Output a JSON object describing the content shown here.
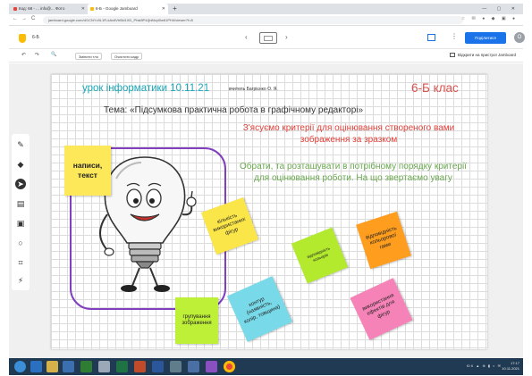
{
  "browser": {
    "tabs": [
      {
        "label": "Код: 68 - ... info@... Фото",
        "active": false
      },
      {
        "label": "6-Б - Google Jamboard",
        "active": true
      }
    ],
    "new_tab": "+",
    "window_controls": "— ▢ ✕",
    "url": "jamboard.google.com/d/1CNYc9L1R-kAv6Vhl5d1XD_Phsl8P4JjbMzyl0w61PH4/viewer?f=8",
    "nav": {
      "back": "←",
      "forward": "→",
      "reload": "C"
    }
  },
  "app": {
    "title": "6-Б",
    "share_label": "Поділитися",
    "avatar_letter": "О",
    "frame_prev": "‹",
    "frame_next": "›",
    "toolbar": {
      "undo": "↶",
      "redo": "↷",
      "zoom": "🔍",
      "set_background": "Змінити тло",
      "clear_frame": "Очистити кадр",
      "open_device": "Відкрити на пристрої Jamboard"
    }
  },
  "board": {
    "lesson_title": "урок інформатики 10.11.21",
    "teacher": "вчитель Багрієнко О. Я.",
    "class_label": "6-Б клас",
    "topic": "Тема: «Підсумкова практична робота в графічному редакторі»",
    "criteria": "З'ясуємо критерії для оцінювання створеного вами зображення за зразком",
    "instruction": "Обрати, та розташувати в потрібному порядку критерії для оцінювання роботи. На що звертаємо увагу",
    "notes": {
      "captions": "написи, текст",
      "shapes": "кількість використаних фігур",
      "colors": "відповідність кольорів",
      "fill": "відповідність кольорової гами",
      "group": "групування зображення",
      "contour": "контур (наявність, колір, товщина)",
      "effects": "використання ефектів для фігур"
    }
  },
  "taskbar": {
    "tray": "ЮК ▲ ⊕ ▮ ◐ ✉",
    "time": "17:17",
    "date": "10.11.2021"
  },
  "colors": {
    "title_teal": "#19a7b8",
    "class_red": "#d9534f",
    "criteria_red": "#e0413a",
    "instruction_green": "#6aa84f",
    "frame_purple": "#7f3fbf",
    "share_blue": "#1a73e8"
  }
}
